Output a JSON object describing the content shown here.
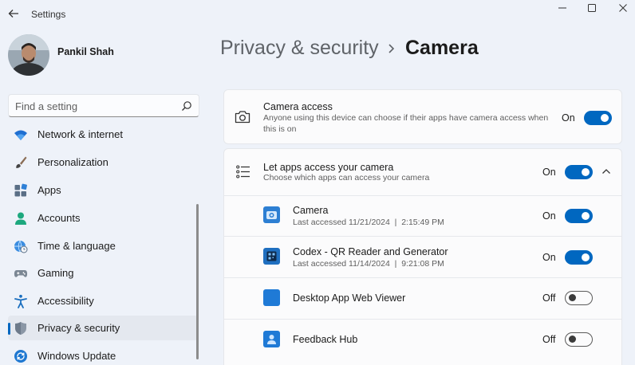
{
  "window": {
    "title": "Settings"
  },
  "profile": {
    "name": "Pankil Shah"
  },
  "search": {
    "placeholder": "Find a setting"
  },
  "sidebar": {
    "items": [
      {
        "label": "Network & internet",
        "icon": "wifi-icon"
      },
      {
        "label": "Personalization",
        "icon": "brush-icon"
      },
      {
        "label": "Apps",
        "icon": "apps-icon"
      },
      {
        "label": "Accounts",
        "icon": "person-icon"
      },
      {
        "label": "Time & language",
        "icon": "globe-clock-icon"
      },
      {
        "label": "Gaming",
        "icon": "gamepad-icon"
      },
      {
        "label": "Accessibility",
        "icon": "accessibility-icon"
      },
      {
        "label": "Privacy & security",
        "icon": "shield-icon",
        "selected": true
      },
      {
        "label": "Windows Update",
        "icon": "refresh-icon"
      }
    ]
  },
  "breadcrumb": {
    "parent": "Privacy & security",
    "current": "Camera"
  },
  "camera_access": {
    "title": "Camera access",
    "description": "Anyone using this device can choose if their apps have camera access when this is on",
    "state": "On",
    "enabled": true
  },
  "apps_access": {
    "title": "Let apps access your camera",
    "description": "Choose which apps can access your camera",
    "state": "On",
    "enabled": true,
    "expanded": true
  },
  "apps": [
    {
      "name": "Camera",
      "last_accessed": "Last accessed 11/21/2024  |  2:15:49 PM",
      "state": "On",
      "enabled": true,
      "icon": "camera-app-icon"
    },
    {
      "name": "Codex - QR Reader and Generator",
      "last_accessed": "Last accessed 11/14/2024  |  9:21:08 PM",
      "state": "On",
      "enabled": true,
      "icon": "qr-code-icon"
    },
    {
      "name": "Desktop App Web Viewer",
      "state": "Off",
      "enabled": false,
      "icon": "web-viewer-icon"
    },
    {
      "name": "Feedback Hub",
      "state": "Off",
      "enabled": false,
      "icon": "feedback-hub-icon"
    }
  ],
  "colors": {
    "accent": "#0067c0",
    "background": "#eef2f9",
    "card": "#fbfbfc"
  }
}
